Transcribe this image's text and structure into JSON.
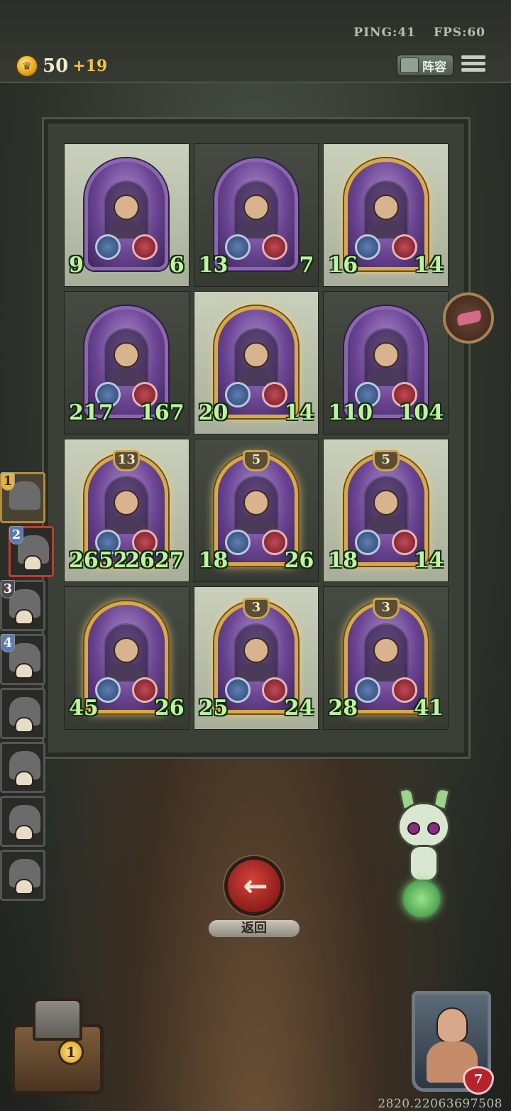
{
  "net": {
    "ping": "PING:41",
    "fps": "FPS:60"
  },
  "coins": {
    "value": "50",
    "bonus": "+19"
  },
  "lineup_label": "阵容",
  "board": [
    {
      "tier": "",
      "atk": "9",
      "hp": "6",
      "frame": "purple",
      "shade": "light"
    },
    {
      "tier": "",
      "atk": "13",
      "hp": "7",
      "frame": "purple",
      "shade": "dark"
    },
    {
      "tier": "",
      "atk": "16",
      "hp": "14",
      "frame": "gold",
      "shade": "light"
    },
    {
      "tier": "",
      "atk": "217",
      "hp": "167",
      "frame": "purple",
      "shade": "dark"
    },
    {
      "tier": "",
      "atk": "20",
      "hp": "14",
      "frame": "gold",
      "shade": "light"
    },
    {
      "tier": "",
      "atk": "110",
      "hp": "104",
      "frame": "purple",
      "shade": "dark"
    },
    {
      "tier": "13",
      "atk": "2652",
      "hp": "2627",
      "frame": "gold",
      "shade": "light"
    },
    {
      "tier": "5",
      "atk": "18",
      "hp": "26",
      "frame": "gold",
      "shade": "dark"
    },
    {
      "tier": "5",
      "atk": "18",
      "hp": "14",
      "frame": "gold",
      "shade": "light"
    },
    {
      "tier": "",
      "atk": "45",
      "hp": "26",
      "frame": "gold",
      "shade": "dark"
    },
    {
      "tier": "3",
      "atk": "25",
      "hp": "24",
      "frame": "gold",
      "shade": "light"
    },
    {
      "tier": "3",
      "atk": "28",
      "hp": "41",
      "frame": "gold",
      "shade": "dark"
    }
  ],
  "queue": [
    {
      "order": "1",
      "style": "gold",
      "state": "active"
    },
    {
      "order": "2",
      "style": "blue",
      "state": "selected"
    },
    {
      "order": "3",
      "style": "grey",
      "state": ""
    },
    {
      "order": "4",
      "style": "blue",
      "state": ""
    },
    {
      "order": "",
      "style": "grey",
      "state": ""
    },
    {
      "order": "",
      "style": "grey",
      "state": ""
    },
    {
      "order": "",
      "style": "grey",
      "state": ""
    },
    {
      "order": "",
      "style": "grey",
      "state": ""
    }
  ],
  "back_label": "返回",
  "chest_count": "1",
  "hero_hp": "7",
  "coords": "2820.22063697508",
  "colors": {
    "accent_gold": "#d7a94a",
    "stat_green": "#bff2a1",
    "back_red": "#c03a32"
  }
}
